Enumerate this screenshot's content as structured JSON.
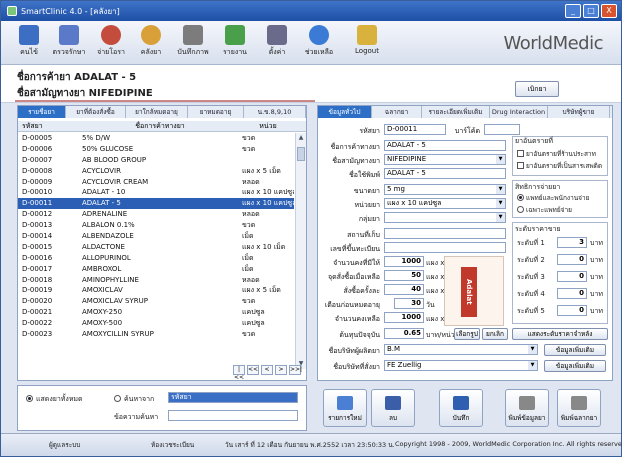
{
  "window": {
    "title": "SmartClinic 4.0 - [คลังยา]",
    "min": "_",
    "max": "□",
    "close": "X"
  },
  "toolbar": {
    "items": [
      {
        "label": "คนไข้",
        "icon": "patient-icon",
        "color": "#3c6fc4"
      },
      {
        "label": "ตรวจรักษา",
        "icon": "doctor-icon",
        "color": "#5a7ac9"
      },
      {
        "label": "จ่ายโอรา",
        "icon": "medicine-icon",
        "color": "#c44c3c"
      },
      {
        "label": "คลังยา",
        "icon": "pill-stock-icon",
        "color": "#d9a03a"
      },
      {
        "label": "บันทึกภาพ",
        "icon": "camera-icon",
        "color": "#7c7c7c"
      },
      {
        "label": "รายงาน",
        "icon": "report-chart-icon",
        "color": "#4aa04a"
      },
      {
        "label": "ตั้งค่า",
        "icon": "settings-icon",
        "color": "#6a6a8a"
      },
      {
        "label": "ช่วยเหลือ",
        "icon": "help-icon",
        "color": "#3b7bd6"
      },
      {
        "label": "Logout",
        "icon": "lock-icon",
        "color": "#d8b23c"
      }
    ],
    "brand": "WorldMedic"
  },
  "header": {
    "trade_name": "ชื่อการค้ายา ADALAT - 5",
    "generic_name": "ชื่อสามัญทางยา NIFEDIPINE",
    "find_button": "เบิกยา"
  },
  "left": {
    "tabs": [
      "รายชื่อยา",
      "ยาที่ต้องสั่งซื้อ",
      "ยาใกล้หมดอายุ",
      "ยาหมดอายุ",
      "น.ข.8,9,10"
    ],
    "columns": [
      "รหัสยา",
      "ชื่อการค้าทางยา",
      "หน่วย"
    ],
    "rows": [
      {
        "code": "D-00005",
        "name": "5% D/W",
        "unit": "ขวด"
      },
      {
        "code": "D-00006",
        "name": "50% GLUCOSE",
        "unit": "ขวด"
      },
      {
        "code": "D-00007",
        "name": "AB BLOOD GROUP",
        "unit": ""
      },
      {
        "code": "D-00008",
        "name": "ACYCLOVIR",
        "unit": "แผง x 5 เม็ด"
      },
      {
        "code": "D-00009",
        "name": "ACYCLOVIR CREAM",
        "unit": "หลอด"
      },
      {
        "code": "D-00010",
        "name": "ADALAT - 10",
        "unit": "แผง x 10 แคปซูล"
      },
      {
        "code": "D-00011",
        "name": "ADALAT - 5",
        "unit": "แผง x 10 แคปซูล"
      },
      {
        "code": "D-00012",
        "name": "ADRENALINE",
        "unit": "หลอด"
      },
      {
        "code": "D-00013",
        "name": "ALBALON 0.1%",
        "unit": "ขวด"
      },
      {
        "code": "D-00014",
        "name": "ALBENDAZOLE",
        "unit": "เม็ด"
      },
      {
        "code": "D-00015",
        "name": "ALDACTONE",
        "unit": "แผง x 10 เม็ด"
      },
      {
        "code": "D-00016",
        "name": "ALLOPURINOL",
        "unit": "เม็ด"
      },
      {
        "code": "D-00017",
        "name": "AMBROXOL",
        "unit": "เม็ด"
      },
      {
        "code": "D-00018",
        "name": "AMINOPHYLLINE",
        "unit": "หลอด"
      },
      {
        "code": "D-00019",
        "name": "AMOXICLAV",
        "unit": "แผง x 5 เม็ด"
      },
      {
        "code": "D-00020",
        "name": "AMOXICLAV SYRUP",
        "unit": "ขวด"
      },
      {
        "code": "D-00021",
        "name": "AMOXY-250",
        "unit": "แคปซูล"
      },
      {
        "code": "D-00022",
        "name": "AMOXY-500",
        "unit": "แคปซูล"
      },
      {
        "code": "D-00023",
        "name": "AMOXYCILLIN SYRUP",
        "unit": "ขวด"
      }
    ],
    "selected_index": 6,
    "pager": [
      "|<<",
      "<<",
      "<",
      ">",
      ">>|"
    ],
    "search": {
      "radio_all": "แสดงยาทั้งหมด",
      "radio_search": "ค้นหาจาก",
      "search_field": "รหัสยา",
      "keyword_label": "ข้อความค้นหา"
    }
  },
  "right": {
    "tabs": [
      "ข้อมูลทั่วไป",
      "ฉลากยา",
      "รายละเอียดเพิ่มเติม",
      "Drug Interaction",
      "บริษัทผู้ขาย"
    ],
    "code_label": "รหัสยา",
    "code": "D-00011",
    "barcode_label": "บาร์โค้ด",
    "trade_label": "ชื่อการค้าทางยา",
    "trade": "ADALAT - 5",
    "generic_label": "ชื่อสามัญทางยา",
    "generic": "NIFEDIPINE",
    "print_label": "ชื่อใช้พิมพ์",
    "print_name": "ADALAT - 5",
    "size_label": "ขนาดยา",
    "size": "5 mg",
    "unit_label": "หน่วยยา",
    "unit": "แผง x 10 แคปซูล",
    "group_label": "กลุ่มยา",
    "location_label": "สถานที่เก็บ",
    "regno_label": "เลขที่ขึ้นทะเบียน",
    "stock_label": "จำนวนคงที่มีให้",
    "stock": "1000",
    "reorder_label": "จุดสั่งซื้อเมื่อเหลือ",
    "reorder": "50",
    "order_label": "สั่งซื้อครั้งละ",
    "order": "40",
    "expire_label": "เตือนก่อนหมดอายุ",
    "expire": "30",
    "expire_unit": "วัน",
    "qty_label": "จำนวนคงเหลือ",
    "qty": "1000",
    "unit_short": "แผง x",
    "cost_label": "ต้นทุนปัจจุบัน",
    "cost": "0.65",
    "cost_unit": "บาท/หน่วย",
    "pick_image": "เลือกรูป",
    "cancel_image": "ยกเลิก",
    "maker_label": "ชื่อบริษัทผู้ผลิตยา",
    "maker": "B.M",
    "maker_btn": "ข้อมูลเพิ่มเติม",
    "seller_label": "ชื่อบริษัทที่สั่งยา",
    "seller": "FE Zuellig",
    "seller_btn": "ข้อมูลเพิ่มเติม",
    "drug_type_title": "ยาอันตรายที่",
    "drug_type_1": "ยาอันตรายที่ร้านประสาท",
    "drug_type_2": "ยาอันตรายที่เป็นสารเสพติด",
    "rights_title": "สิทธิการจ่ายยา",
    "rights_1": "แพทย์และพนักงานจ่าย",
    "rights_2": "เฉพาะแพทย์จ่าย",
    "price_title": "ระดับราคาขาย",
    "price_levels": [
      {
        "label": "ระดับที่ 1",
        "value": "3",
        "unit": "บาท"
      },
      {
        "label": "ระดับที่ 2",
        "value": "0",
        "unit": "บาท"
      },
      {
        "label": "ระดับที่ 3",
        "value": "0",
        "unit": "บาท"
      },
      {
        "label": "ระดับที่ 4",
        "value": "0",
        "unit": "บาท"
      },
      {
        "label": "ระดับที่ 5",
        "value": "0",
        "unit": "บาท"
      }
    ],
    "more_price_btn": "แสดงระดับราคาจำหลัง",
    "box_text": "Adalat"
  },
  "actions": [
    {
      "label": "รายการใหม่",
      "icon": "new-document-icon",
      "color": "#4a7fd4"
    },
    {
      "label": "ลบ",
      "icon": "delete-icon",
      "color": "#3a5ea8"
    },
    {
      "label": "บันทึก",
      "icon": "save-icon",
      "color": "#2f5fb0"
    },
    {
      "label": "พิมพ์ข้อมูลยา",
      "icon": "printer-icon",
      "color": "#888"
    },
    {
      "label": "พิมพ์ฉลากยา",
      "icon": "label-printer-icon",
      "color": "#888"
    }
  ],
  "status": {
    "user": "ผู้ดูแลระบบ",
    "room": "ห้องเวชระเบียน",
    "datetime": "วัน เสาร์ ที่ 12 เดือน กันยายน พ.ศ.2552 เวลา 23:50:33 น.",
    "copyright": "Copyright 1998 - 2009, WorldMedic Corporation Inc. All rights reserved."
  }
}
